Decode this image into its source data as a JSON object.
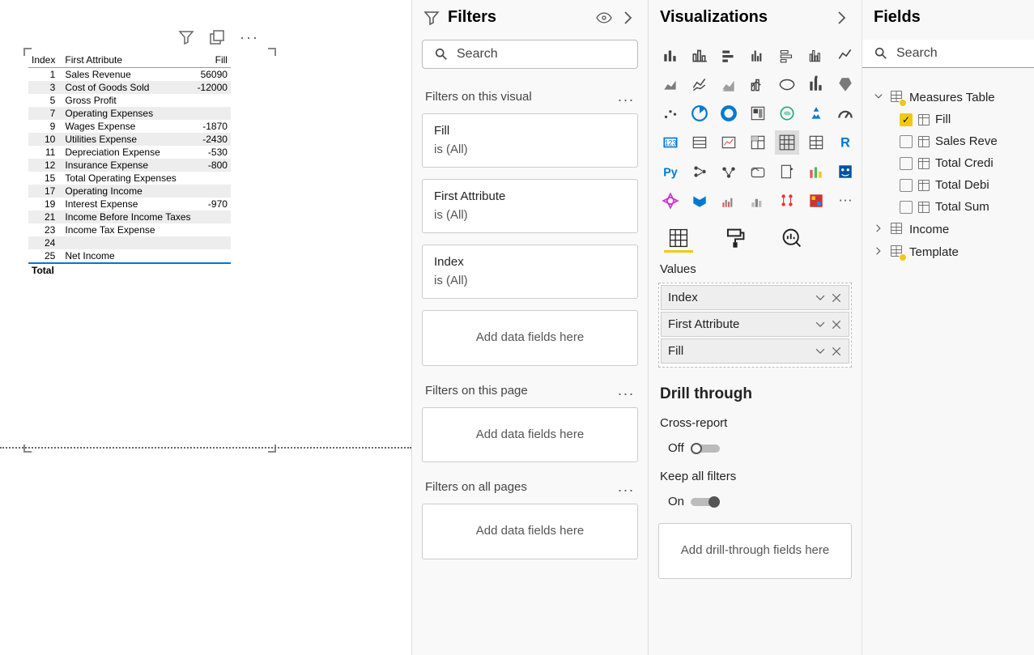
{
  "canvas": {
    "table": {
      "columns": [
        "Index",
        "First Attribute",
        "Fill"
      ],
      "rows": [
        {
          "idx": 1,
          "attr": "Sales Revenue",
          "fill": "56090"
        },
        {
          "idx": 3,
          "attr": "Cost of Goods Sold",
          "fill": "-12000"
        },
        {
          "idx": 5,
          "attr": "Gross Profit",
          "fill": ""
        },
        {
          "idx": 7,
          "attr": "Operating Expenses",
          "fill": ""
        },
        {
          "idx": 9,
          "attr": "Wages Expense",
          "fill": "-1870"
        },
        {
          "idx": 10,
          "attr": "Utilities Expense",
          "fill": "-2430"
        },
        {
          "idx": 11,
          "attr": "Depreciation Expense",
          "fill": "-530"
        },
        {
          "idx": 12,
          "attr": "Insurance Expense",
          "fill": "-800"
        },
        {
          "idx": 15,
          "attr": "Total Operating Expenses",
          "fill": ""
        },
        {
          "idx": 17,
          "attr": "Operating Income",
          "fill": ""
        },
        {
          "idx": 19,
          "attr": "Interest Expense",
          "fill": "-970"
        },
        {
          "idx": 21,
          "attr": "Income Before Income Taxes",
          "fill": ""
        },
        {
          "idx": 23,
          "attr": "Income Tax Expense",
          "fill": ""
        },
        {
          "idx": 24,
          "attr": "",
          "fill": ""
        },
        {
          "idx": 25,
          "attr": "Net Income",
          "fill": ""
        }
      ],
      "total_label": "Total"
    }
  },
  "filters": {
    "title": "Filters",
    "search_placeholder": "Search",
    "sections": {
      "visual": {
        "label": "Filters on this visual",
        "cards": [
          {
            "name": "Fill",
            "value": "is (All)"
          },
          {
            "name": "First Attribute",
            "value": "is (All)"
          },
          {
            "name": "Index",
            "value": "is (All)"
          }
        ],
        "drop_text": "Add data fields here"
      },
      "page": {
        "label": "Filters on this page",
        "drop_text": "Add data fields here"
      },
      "all": {
        "label": "Filters on all pages",
        "drop_text": "Add data fields here"
      }
    }
  },
  "viz": {
    "title": "Visualizations",
    "values_label": "Values",
    "values": [
      "Index",
      "First Attribute",
      "Fill"
    ],
    "drill": {
      "title": "Drill through",
      "cross_label": "Cross-report",
      "cross_state": "Off",
      "keep_label": "Keep all filters",
      "keep_state": "On",
      "drop_text": "Add drill-through fields here"
    }
  },
  "fields": {
    "title": "Fields",
    "search_placeholder": "Search",
    "tables": [
      {
        "name": "Measures Table",
        "expanded": true,
        "badge": true,
        "items": [
          {
            "name": "Fill",
            "checked": true
          },
          {
            "name": "Sales Revenue",
            "checked": false,
            "truncated": "Sales Reve"
          },
          {
            "name": "Total Credit",
            "checked": false,
            "truncated": "Total Credi"
          },
          {
            "name": "Total Debit",
            "checked": false,
            "truncated": "Total Debi"
          },
          {
            "name": "Total Sum",
            "checked": false
          }
        ]
      },
      {
        "name": "Income",
        "expanded": false,
        "badge": false
      },
      {
        "name": "Template",
        "expanded": false,
        "badge": true
      }
    ]
  }
}
